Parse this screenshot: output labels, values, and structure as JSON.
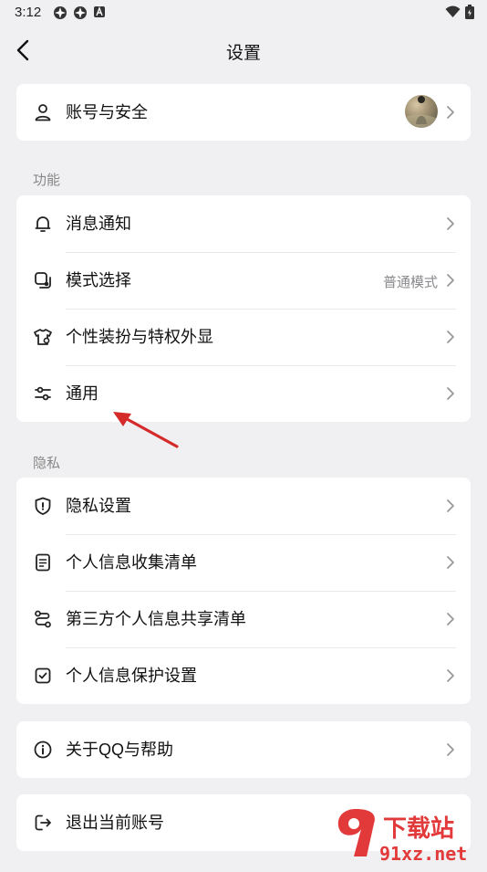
{
  "status_bar": {
    "time": "3:12"
  },
  "nav": {
    "title": "设置"
  },
  "account": {
    "label": "账号与安全"
  },
  "sections": {
    "features_label": "功能",
    "privacy_label": "隐私"
  },
  "features": [
    {
      "label": "消息通知",
      "icon": "bell-icon"
    },
    {
      "label": "模式选择",
      "value": "普通模式",
      "icon": "mode-icon"
    },
    {
      "label": "个性装扮与特权外显",
      "icon": "tshirt-icon"
    },
    {
      "label": "通用",
      "icon": "sliders-icon"
    }
  ],
  "privacy": [
    {
      "label": "隐私设置",
      "icon": "shield-icon"
    },
    {
      "label": "个人信息收集清单",
      "icon": "document-icon"
    },
    {
      "label": "第三方个人信息共享清单",
      "icon": "share-nodes-icon"
    },
    {
      "label": "个人信息保护设置",
      "icon": "checkbox-icon"
    }
  ],
  "about": {
    "label": "关于QQ与帮助",
    "icon": "info-icon"
  },
  "logout": {
    "label": "退出当前账号",
    "icon": "logout-icon"
  },
  "watermark": {
    "title": "下载站",
    "url": "91xz.net"
  },
  "colors": {
    "background": "#f0f0f2",
    "card": "#ffffff",
    "secondary_text": "#8a8a8e",
    "annotation_arrow": "#d42a2a",
    "watermark_red": "#e23a3a"
  }
}
